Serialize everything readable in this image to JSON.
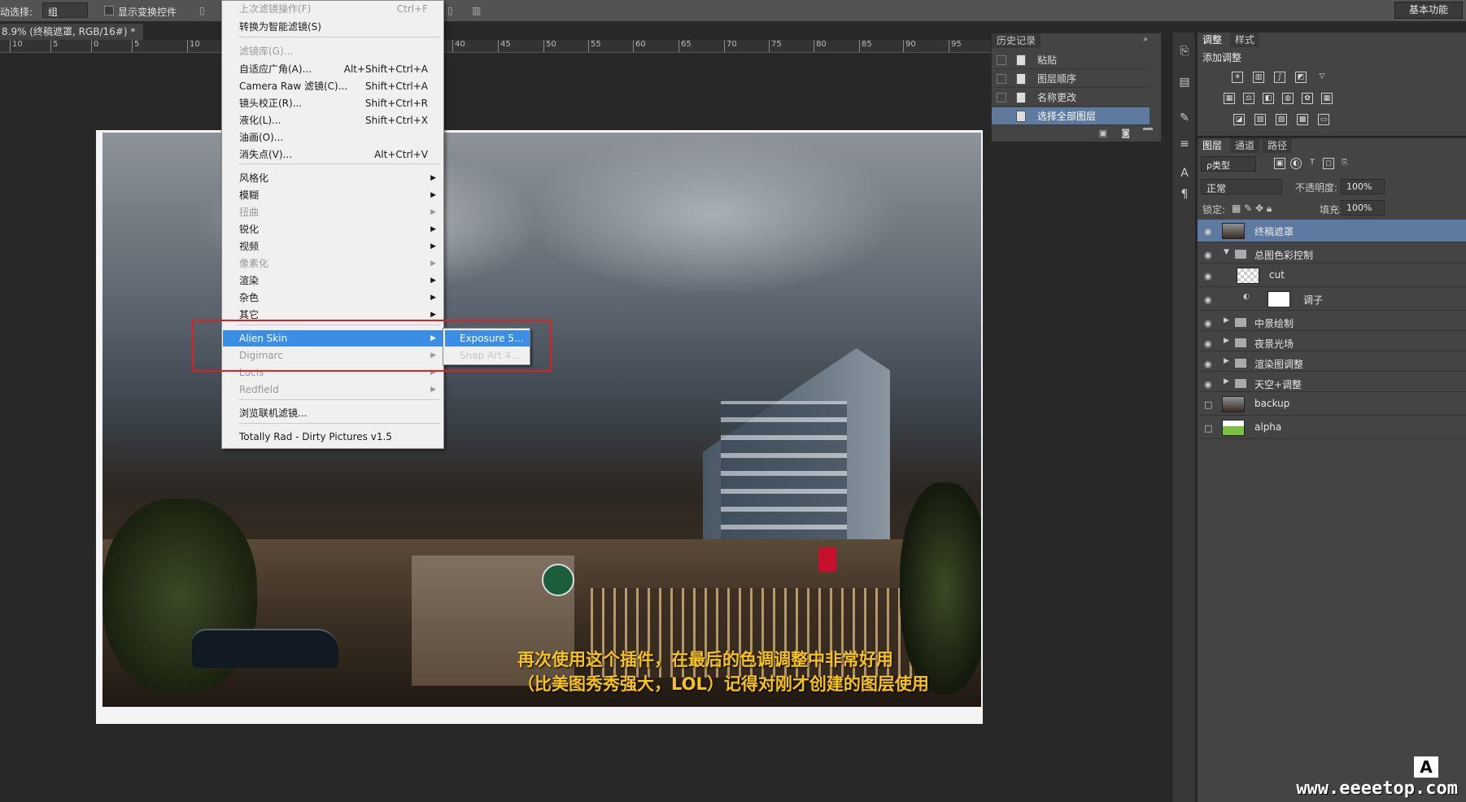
{
  "options_bar": {
    "auto_select_label": "动选择:",
    "auto_select_value": "组",
    "show_transform_label": "显示变换控件",
    "workspace": "基本功能"
  },
  "document": {
    "tab_title": "8.9% (终稿遮罩, RGB/16#) *",
    "close": "×"
  },
  "ruler_ticks": [
    "10",
    "5",
    "0",
    "5",
    "10",
    "40",
    "45",
    "50",
    "55",
    "60",
    "65",
    "70",
    "75",
    "80",
    "85",
    "90",
    "95"
  ],
  "filter_menu": {
    "items": [
      {
        "label": "上次滤镜操作(F)",
        "shortcut": "Ctrl+F",
        "disabled": true
      },
      {
        "label": "转换为智能滤镜(S)",
        "shortcut": ""
      },
      {
        "label": "滤镜库(G)...",
        "shortcut": "",
        "disabled": true
      },
      {
        "label": "自适应广角(A)...",
        "shortcut": "Alt+Shift+Ctrl+A"
      },
      {
        "label": "Camera Raw 滤镜(C)...",
        "shortcut": "Shift+Ctrl+A"
      },
      {
        "label": "镜头校正(R)...",
        "shortcut": "Shift+Ctrl+R"
      },
      {
        "label": "液化(L)...",
        "shortcut": "Shift+Ctrl+X"
      },
      {
        "label": "油画(O)...",
        "shortcut": ""
      },
      {
        "label": "消失点(V)...",
        "shortcut": "Alt+Ctrl+V"
      },
      {
        "label": "风格化"
      },
      {
        "label": "模糊"
      },
      {
        "label": "扭曲",
        "disabled": true
      },
      {
        "label": "锐化"
      },
      {
        "label": "视频"
      },
      {
        "label": "像素化",
        "disabled": true
      },
      {
        "label": "渲染"
      },
      {
        "label": "杂色"
      },
      {
        "label": "其它"
      },
      {
        "label": "Alien Skin"
      },
      {
        "label": "Digimarc",
        "disabled": true
      },
      {
        "label": "Lucis",
        "disabled": true
      },
      {
        "label": "Redfield",
        "disabled": true
      },
      {
        "label": "浏览联机滤镜..."
      },
      {
        "label": "Totally Rad - Dirty Pictures v1.5"
      }
    ],
    "submenu": [
      "Exposure 5...",
      "Snap Art 4..."
    ]
  },
  "caption": {
    "line1": "再次使用这个插件，在最后的色调调整中非常好用",
    "line2": "（比美图秀秀强大，LOL）记得对刚才创建的图层使用"
  },
  "history_panel": {
    "tab": "历史记录",
    "rows": [
      "粘贴",
      "图层顺序",
      "名称更改",
      "选择全部图层"
    ]
  },
  "adjust_panel": {
    "tabs": [
      "调整",
      "样式"
    ],
    "title": "添加调整"
  },
  "layers_panel": {
    "tabs": [
      "图层",
      "通道",
      "路径"
    ],
    "kind_filter": "ρ类型",
    "blend_mode": "正常",
    "opacity_label": "不透明度:",
    "opacity_value": "100%",
    "lock_label": "锁定:",
    "fill_label": "填充:",
    "fill_value": "100%",
    "layers": [
      {
        "name": "终稿遮罩",
        "type": "image",
        "active": true
      },
      {
        "name": "总图色彩控制",
        "type": "group-open"
      },
      {
        "name": "cut",
        "type": "transparent"
      },
      {
        "name": "调子",
        "type": "adjust"
      },
      {
        "name": "中景绘制",
        "type": "group"
      },
      {
        "name": "夜景光场",
        "type": "group"
      },
      {
        "name": "渲染图调整",
        "type": "group"
      },
      {
        "name": "天空+调整",
        "type": "group"
      },
      {
        "name": "backup",
        "type": "image-hidden"
      },
      {
        "name": "alpha",
        "type": "image-hidden"
      }
    ]
  },
  "watermark": {
    "site": "www.eeeetop.com",
    "badge": "A"
  },
  "colors": {
    "menu_highlight": "#3a8ee6",
    "selection": "#5e7aa0",
    "red_annotation": "#e02020",
    "caption": "#f7c21a"
  }
}
